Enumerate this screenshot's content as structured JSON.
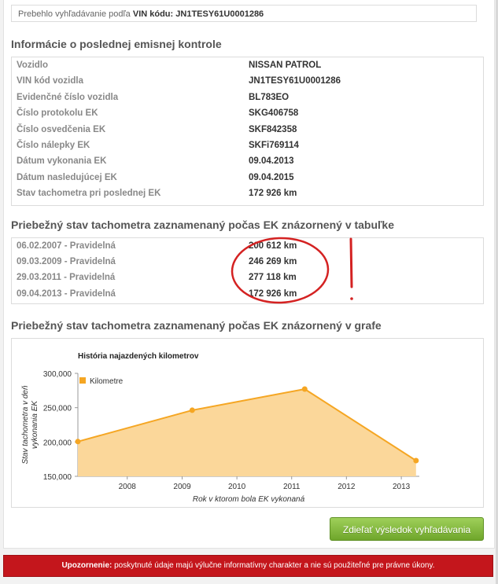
{
  "search": {
    "prefix": "Prebehlo vyhľadávanie podľa",
    "vin_label": "VIN kódu:",
    "vin_value": "JN1TESY61U0001286"
  },
  "emission": {
    "title": "Informácie o poslednej emisnej kontrole",
    "rows": [
      {
        "label": "Vozidlo",
        "value": "NISSAN PATROL"
      },
      {
        "label": "VIN kód vozidla",
        "value": "JN1TESY61U0001286"
      },
      {
        "label": "Evidenčné číslo vozidla",
        "value": "BL783EO"
      },
      {
        "label": "Číslo protokolu EK",
        "value": "SKG406758"
      },
      {
        "label": "Číslo osvedčenia EK",
        "value": "SKF842358"
      },
      {
        "label": "Číslo nálepky EK",
        "value": "SKFi769114"
      },
      {
        "label": "Dátum vykonania EK",
        "value": "09.04.2013"
      },
      {
        "label": "Dátum nasledujúcej EK",
        "value": "09.04.2015"
      },
      {
        "label": "Stav tachometra pri poslednej EK",
        "value": "172 926 km"
      }
    ]
  },
  "odometer_table": {
    "title": "Priebežný stav tachometra zaznamenaný počas EK znázornený v tabuľke",
    "rows": [
      {
        "label": "06.02.2007 - Pravidelná",
        "value": "200 612 km"
      },
      {
        "label": "09.03.2009 - Pravidelná",
        "value": "246 269 km"
      },
      {
        "label": "29.03.2011 - Pravidelná",
        "value": "277 118 km"
      },
      {
        "label": "09.04.2013 - Pravidelná",
        "value": "172 926 km"
      }
    ],
    "annotation": "!"
  },
  "odometer_chart": {
    "section_title": "Priebežný stav tachometra zaznamenaný počas EK znázornený v grafe"
  },
  "chart_data": {
    "type": "area",
    "title": "História najazdených kilometrov",
    "xlabel": "Rok v ktorom bola EK vykonaná",
    "ylabel": "Stav tachometra v deň vykonania EK",
    "ylabel_lines": [
      "Stav tachometra v deň",
      "vykonania EK"
    ],
    "x_ticks": [
      "2008",
      "2009",
      "2010",
      "2011",
      "2012",
      "2013"
    ],
    "y_ticks": [
      "150,000",
      "200,000",
      "250,000",
      "300,000"
    ],
    "ylim": [
      150000,
      300000
    ],
    "xlim": [
      "2007-02-06",
      "2013-05-01"
    ],
    "legend_position": "top-left",
    "series": [
      {
        "name": "Kilometre",
        "color": "#f5a623",
        "fill": "#fbd79a",
        "points": [
          {
            "x": "2007-02-06",
            "y": 200612
          },
          {
            "x": "2009-03-09",
            "y": 246269
          },
          {
            "x": "2011-03-29",
            "y": 277118
          },
          {
            "x": "2013-04-09",
            "y": 172926
          }
        ]
      }
    ]
  },
  "share_button": {
    "label": "Zdieľať výsledok vyhľadávania",
    "color": "#7cb342"
  },
  "warning": {
    "bold": "Upozornenie:",
    "text": "poskytnuté údaje majú výlučne informatívny charakter a nie sú použiteľné pre právne úkony.",
    "color": "#c4161c"
  }
}
